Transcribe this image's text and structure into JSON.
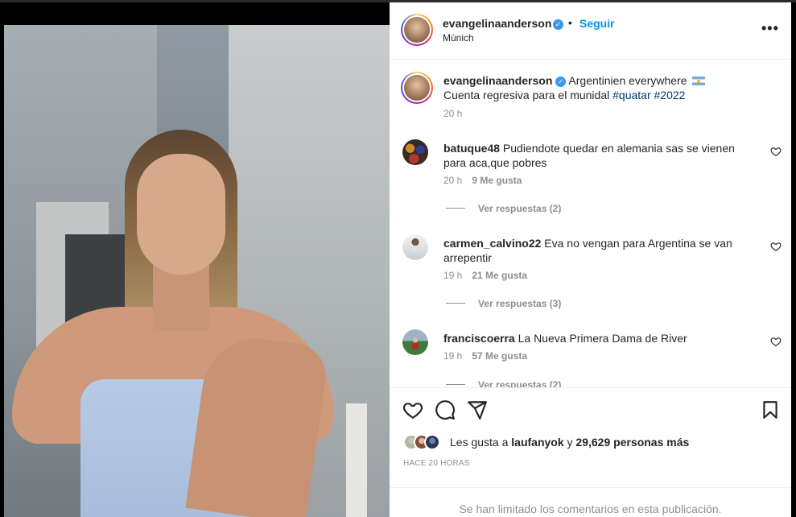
{
  "post": {
    "username": "evangelinaanderson",
    "verified_mark": "✓",
    "separator": "•",
    "follow_label": "Seguir",
    "location": "Múnich",
    "more_label": "•••"
  },
  "caption": {
    "username": "evangelinaanderson",
    "text_line1": "Argentinien everywhere",
    "flag_icon": "argentina-flag-icon",
    "text_line2_prefix": "Cuenta regresiva para el munidal ",
    "hashtag1": "#quatar",
    "hashtag2": "#2022",
    "time": "20 h"
  },
  "comments": [
    {
      "username": "batuque48",
      "text": "Pudiendote quedar en alemania sas se vienen para aca,que pobres",
      "time": "20 h",
      "likes": "9 Me gusta",
      "replies": "Ver respuestas (2)"
    },
    {
      "username": "carmen_calvino22",
      "text": "Eva no vengan para Argentina se van arrepentir",
      "time": "19 h",
      "likes": "21 Me gusta",
      "replies": "Ver respuestas (3)"
    },
    {
      "username": "franciscoerra",
      "text": "La Nueva Primera Dama de River",
      "time": "19 h",
      "likes": "57 Me gusta",
      "replies": "Ver respuestas (2)"
    }
  ],
  "actions": {
    "icons": [
      "heart-icon",
      "comment-icon",
      "share-icon",
      "bookmark-icon"
    ],
    "likes_prefix": "Les gusta a ",
    "likes_user": "laufanyok",
    "likes_middle": " y ",
    "likes_count": "29,629 personas más",
    "ago": "HACE 20 HORAS",
    "limited_notice": "Se han limitado los comentarios en esta publicación."
  },
  "colors": {
    "accent": "#0095f6",
    "verified": "#3897f0",
    "muted": "#8e8e8e",
    "hashtag": "#00376b"
  }
}
